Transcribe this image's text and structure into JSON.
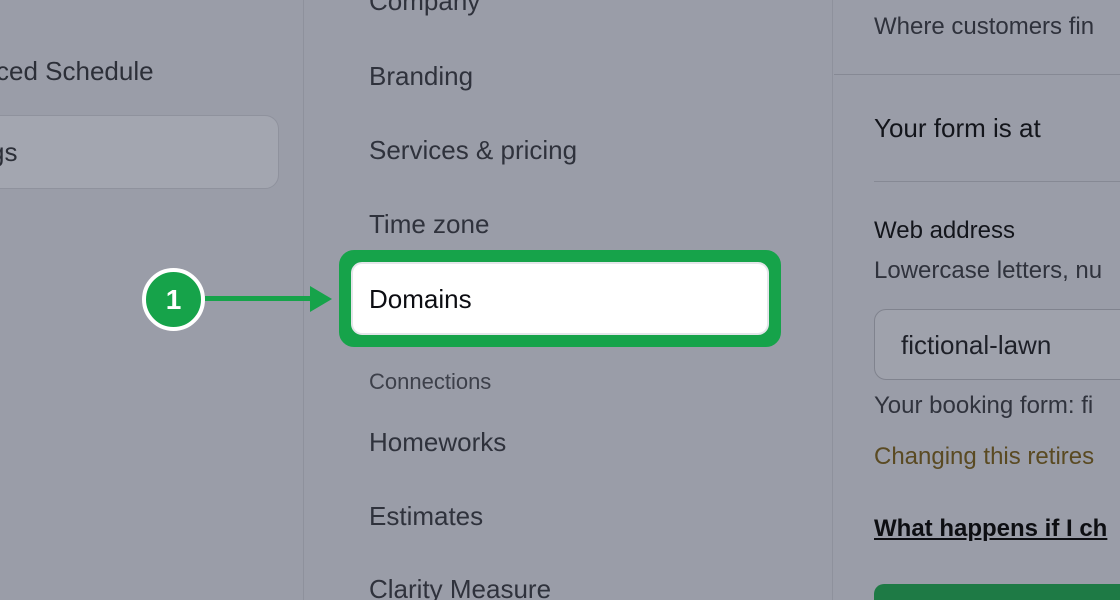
{
  "left_nav": {
    "schedule_label": "ced Schedule",
    "settings_label": "gs"
  },
  "settings_nav": {
    "items_top": [
      "Company",
      "Branding",
      "Services & pricing",
      "Time zone"
    ],
    "active_item": "Domains",
    "section_heading": "Connections",
    "items_bottom": [
      "Homeworks",
      "Estimates",
      "Clarity Measure"
    ]
  },
  "callout": {
    "step": "1",
    "color": "#16a34a"
  },
  "content": {
    "intro": "Where customers fin",
    "form_heading": "Your form is at",
    "web_address_label": "Web address",
    "web_address_hint": "Lowercase letters, nu",
    "web_address_value": "fictional-lawn",
    "booking_form_text": "Your booking form: fi",
    "warning_text": "Changing this retires",
    "help_link": "What happens if I ch"
  }
}
